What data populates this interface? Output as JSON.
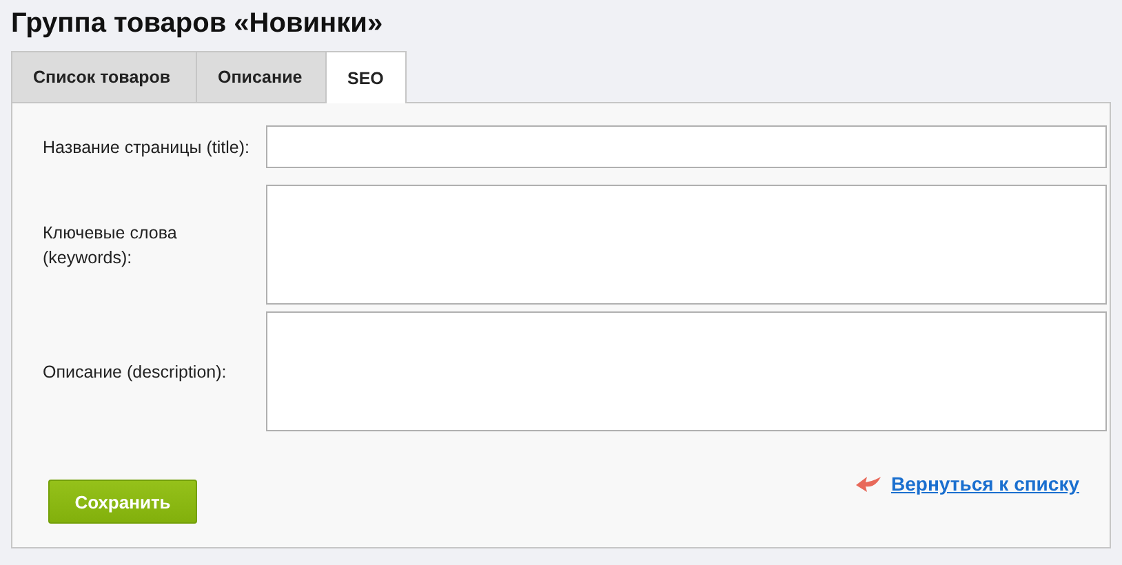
{
  "page_title": "Группа товаров «Новинки»",
  "tabs": [
    {
      "label": "Список товаров",
      "selected": false
    },
    {
      "label": "Описание",
      "selected": false
    },
    {
      "label": "SEO",
      "selected": true
    }
  ],
  "fields": [
    {
      "kind": "input",
      "label": "Название страницы (title):"
    },
    {
      "kind": "textarea",
      "label": "Ключевые слова (keywords):"
    },
    {
      "kind": "textarea",
      "label": "Описание (description):"
    }
  ],
  "save_button": "Сохранить",
  "back_link": "Вернуться к списку"
}
